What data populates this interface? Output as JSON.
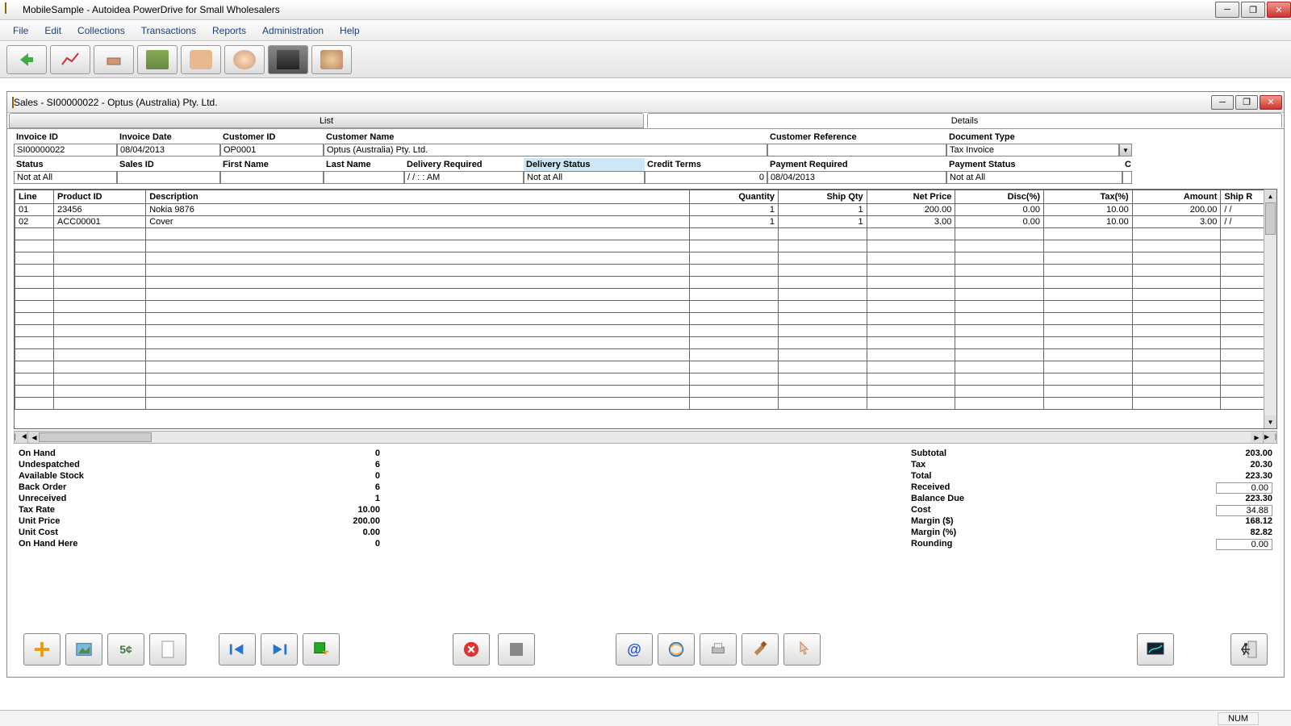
{
  "window": {
    "title": "MobileSample - Autoidea PowerDrive for Small Wholesalers"
  },
  "menu": [
    "File",
    "Edit",
    "Collections",
    "Transactions",
    "Reports",
    "Administration",
    "Help"
  ],
  "child": {
    "title": "Sales - SI00000022 - Optus (Australia) Pty. Ltd."
  },
  "tabs": {
    "list": "List",
    "details": "Details"
  },
  "header": {
    "invoice_id": {
      "label": "Invoice ID",
      "value": "SI00000022"
    },
    "invoice_date": {
      "label": "Invoice Date",
      "value": "08/04/2013"
    },
    "customer_id": {
      "label": "Customer ID",
      "value": "OP0001"
    },
    "customer_name": {
      "label": "Customer Name",
      "value": "Optus (Australia) Pty. Ltd."
    },
    "customer_ref": {
      "label": "Customer Reference",
      "value": ""
    },
    "doc_type": {
      "label": "Document Type",
      "value": "Tax Invoice"
    },
    "status": {
      "label": "Status",
      "value": "Not at All"
    },
    "sales_id": {
      "label": "Sales ID",
      "value": ""
    },
    "first_name": {
      "label": "First Name",
      "value": ""
    },
    "last_name": {
      "label": "Last Name",
      "value": ""
    },
    "delivery_req": {
      "label": "Delivery Required",
      "value": "/  /       :   :    AM"
    },
    "delivery_status": {
      "label": "Delivery Status",
      "value": "Not at All"
    },
    "credit_terms": {
      "label": "Credit Terms",
      "value": "0"
    },
    "payment_req": {
      "label": "Payment Required",
      "value": "08/04/2013"
    },
    "payment_status": {
      "label": "Payment Status",
      "value": "Not at All"
    },
    "extra_c": {
      "label": "C",
      "value": ""
    }
  },
  "grid": {
    "cols": [
      "Line",
      "Product ID",
      "Description",
      "Quantity",
      "Ship Qty",
      "Net Price",
      "Disc(%)",
      "Tax(%)",
      "Amount",
      "Ship R"
    ],
    "rows": [
      {
        "line": "01",
        "pid": "23456",
        "desc": "Nokia 9876",
        "qty": "1",
        "sqty": "1",
        "net": "200.00",
        "disc": "0.00",
        "tax": "10.00",
        "amt": "200.00",
        "shipr": "/  /"
      },
      {
        "line": "02",
        "pid": "ACC00001",
        "desc": "Cover",
        "qty": "1",
        "sqty": "1",
        "net": "3.00",
        "disc": "0.00",
        "tax": "10.00",
        "amt": "3.00",
        "shipr": "/  /"
      }
    ]
  },
  "left_summary": [
    {
      "lbl": "On Hand",
      "val": "0"
    },
    {
      "lbl": "Undespatched",
      "val": "6"
    },
    {
      "lbl": "Available Stock",
      "val": "0"
    },
    {
      "lbl": "Back Order",
      "val": "6"
    },
    {
      "lbl": "Unreceived",
      "val": "1"
    },
    {
      "lbl": "Tax Rate",
      "val": "10.00"
    },
    {
      "lbl": "Unit Price",
      "val": "200.00"
    },
    {
      "lbl": "Unit Cost",
      "val": "0.00"
    },
    {
      "lbl": "On Hand Here",
      "val": "0"
    }
  ],
  "right_summary": [
    {
      "lbl": "Subtotal",
      "val": "203.00",
      "box": false
    },
    {
      "lbl": "Tax",
      "val": "20.30",
      "box": false
    },
    {
      "lbl": "Total",
      "val": "223.30",
      "box": false
    },
    {
      "lbl": "Received",
      "val": "0.00",
      "box": true
    },
    {
      "lbl": "Balance Due",
      "val": "223.30",
      "box": false
    },
    {
      "lbl": "Cost",
      "val": "34.88",
      "box": true
    },
    {
      "lbl": "Margin ($)",
      "val": "168.12",
      "box": false
    },
    {
      "lbl": "Margin (%)",
      "val": "82.82",
      "box": false
    },
    {
      "lbl": "Rounding",
      "val": "0.00",
      "box": true
    }
  ],
  "status": {
    "num": "NUM"
  }
}
